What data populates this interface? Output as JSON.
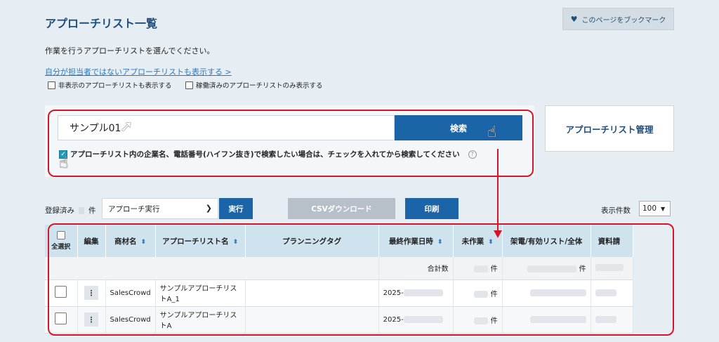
{
  "page": {
    "title": "アプローチリスト一覧",
    "bookmark_label": "このページをブックマーク",
    "instruction": "作業を行うアプローチリストを選んでください。",
    "toggle_link": "自分が担当者ではないアプローチリストも表示する >",
    "checkbox_hidden": "非表示のアプローチリストも表示する",
    "checkbox_active_only": "稼働済みのアプローチリストのみ表示する"
  },
  "search": {
    "value": "サンプル01",
    "button_label": "検索",
    "hint": "アプローチリスト内の企業名、電話番号(ハイフン抜き)で検索したい場合は、チェックを入れてから検索してください",
    "help_icon": "?"
  },
  "manage_button": "アプローチリスト管理",
  "toolbar": {
    "registered_label": "登録済み",
    "registered_unit": "件",
    "action_select": "アプローチ実行",
    "exec_label": "実行",
    "csv_label": "CSVダウンロード",
    "print_label": "印刷",
    "per_page_label": "表示件数",
    "per_page_value": "100"
  },
  "table": {
    "headers": {
      "select_all": "全選択",
      "edit": "編集",
      "product": "商材名",
      "list_name": "アプローチリスト名",
      "planning_tag": "プランニングタグ",
      "last_work": "最終作業日時",
      "unworked": "未作業",
      "calls": "架電/有効リスト/全体",
      "materials": "資料請"
    },
    "total_row": {
      "label": "合計数",
      "unit": "件"
    },
    "rows": [
      {
        "product": "SalesCrowd",
        "list_name": "サンプルアプローチリストA_1",
        "last_work": "2025-",
        "unit": "件"
      },
      {
        "product": "SalesCrowd",
        "list_name": "サンプルアプローチリストA",
        "last_work": "2025-",
        "unit": "件"
      }
    ]
  },
  "colors": {
    "accent": "#1c64a8",
    "highlight": "#d7152a",
    "header_bg": "#cfe3ee"
  }
}
